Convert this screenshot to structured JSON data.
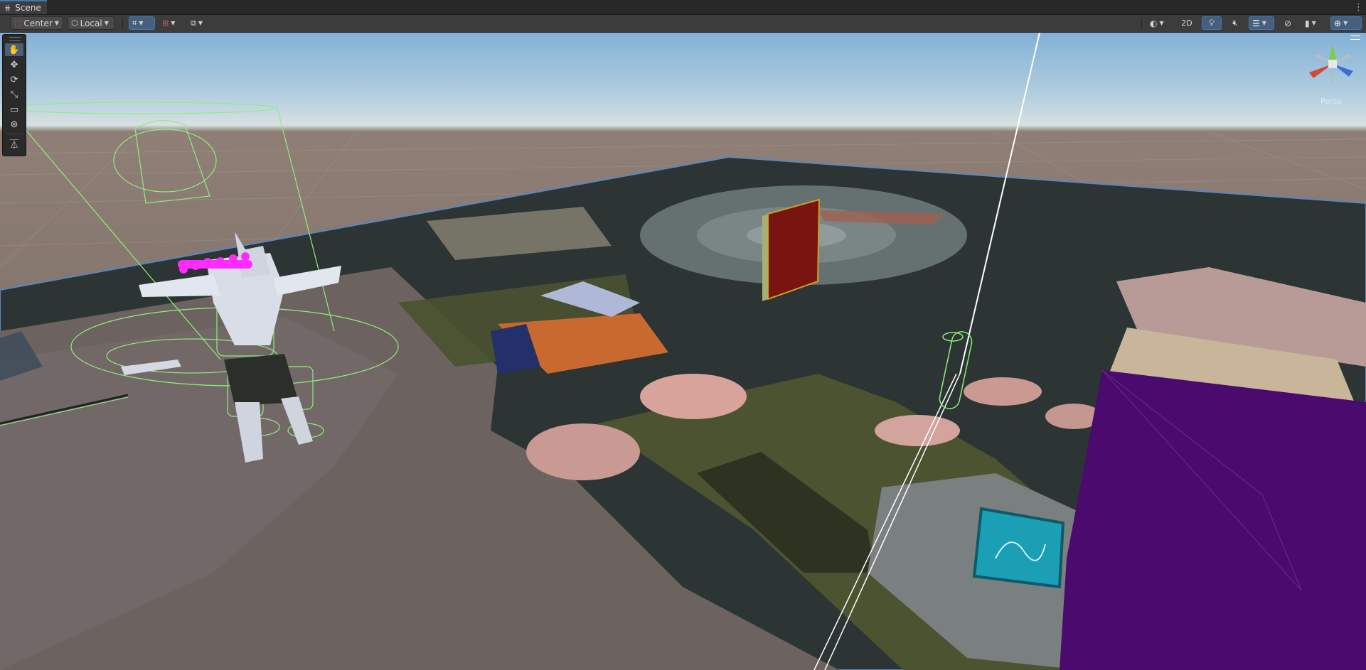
{
  "window": {
    "tab_title": "Scene",
    "tab_icon": "hash-grid-icon",
    "menu_icon": "kebab-menu-icon"
  },
  "toolbar": {
    "pivot_label": "Center",
    "space_label": "Local",
    "mode_2d_label": "2D"
  },
  "scene_tools": [
    {
      "name": "view-tool",
      "glyph": "✋",
      "selected": true
    },
    {
      "name": "move-tool",
      "glyph": "✥",
      "selected": false
    },
    {
      "name": "rotate-tool",
      "glyph": "⟳",
      "selected": false
    },
    {
      "name": "scale-tool",
      "glyph": "⤡",
      "selected": false
    },
    {
      "name": "rect-tool",
      "glyph": "▭",
      "selected": false
    },
    {
      "name": "transform-tool",
      "glyph": "⊛",
      "selected": false
    },
    {
      "name": "custom-tool",
      "glyph": "⏄",
      "selected": false
    }
  ],
  "gizmo": {
    "projection_label": "Persp",
    "axis_colors": {
      "x": "#d14a3a",
      "y": "#7ccf3c",
      "z": "#3b6fd6"
    }
  },
  "colors": {
    "accent": "#3a79bb",
    "collider_green": "#8ef07a",
    "selection_magenta": "#ff2bff",
    "purple_cube": "#4a0a6e",
    "red_panel": "#7a1410"
  }
}
